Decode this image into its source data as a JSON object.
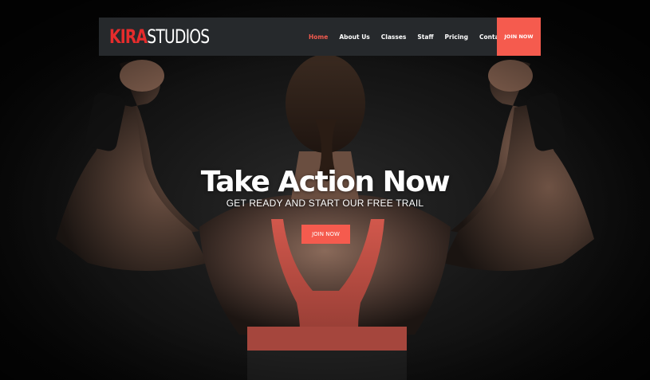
{
  "brand": {
    "logo_part1": "KIRA",
    "logo_part2": "STUDIOS",
    "accent_color": "#f55b4e",
    "logo_red": "#e62c2c"
  },
  "nav": {
    "items": [
      {
        "label": "Home",
        "active": true
      },
      {
        "label": "About Us",
        "active": false
      },
      {
        "label": "Classes",
        "active": false
      },
      {
        "label": "Staff",
        "active": false
      },
      {
        "label": "Pricing",
        "active": false
      },
      {
        "label": "Contact Us",
        "active": false
      }
    ],
    "cta_label": "JOIN NOW"
  },
  "hero": {
    "headline": "Take Action Now",
    "subline": "GET READY AND START OUR FREE TRAIL",
    "cta_label": "JOIN NOW",
    "background_icon": "athlete-flexing-photo"
  }
}
